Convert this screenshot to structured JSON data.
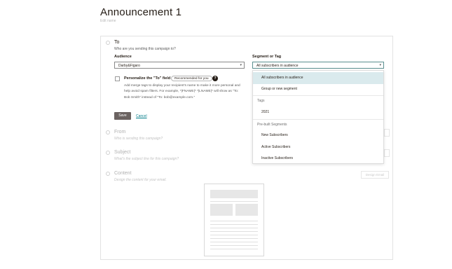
{
  "page": {
    "title": "Announcement 1",
    "edit_name": "Edit name"
  },
  "to_section": {
    "title": "To",
    "subtitle": "Who are you sending this campaign to?",
    "audience_label": "Audience",
    "audience_value": "Darby&Figaro",
    "segment_label": "Segment or Tag",
    "segment_value": "All subscribers in audience",
    "personalize_label": "Personalize the \"To\" field",
    "recommended_badge": "Recommended for you",
    "help_icon_glyph": "?",
    "personalize_desc_1": "Add merge tags to display your recipient's name to make it more personal and",
    "personalize_desc_2": "help avoid spam filters. For example, *|FNAME|* *|LNAME|* will show as \"To:",
    "personalize_desc_3": "Bob Smith\" instead of \"To: bob@example.com.\"",
    "save_label": "Save",
    "cancel_label": "Cancel"
  },
  "from_section": {
    "title": "From",
    "subtitle": "Who is sending this campaign?"
  },
  "subject_section": {
    "title": "Subject",
    "subtitle": "What's the subject line for this campaign?"
  },
  "content_section": {
    "title": "Content",
    "subtitle": "Design the content for your email.",
    "design_button": "Design Email"
  },
  "segment_dropdown": {
    "items": [
      {
        "label": "All subscribers in audience",
        "selected": true
      },
      {
        "label": "Group or new segment"
      }
    ],
    "tags_header": "Tags",
    "tags": [
      "2021"
    ],
    "prebuilt_header": "Pre-built Segments",
    "prebuilt": [
      "New Subscribers",
      "Active Subscribers",
      "Inactive Subscribers"
    ]
  },
  "colors": {
    "accent": "#007c89",
    "save_button": "#6b6361",
    "selected_row": "#daeaed"
  }
}
